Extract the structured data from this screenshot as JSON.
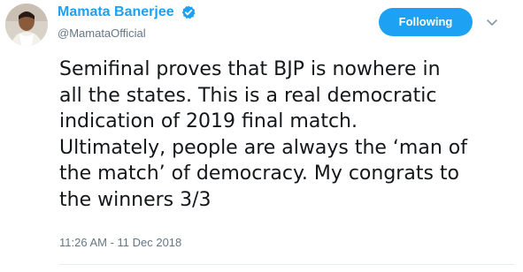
{
  "user": {
    "display_name": "Mamata Banerjee",
    "handle": "@MamataOfficial",
    "verified_icon": "verified-badge-icon"
  },
  "actions": {
    "follow_label": "Following",
    "more_icon": "chevron-down-icon"
  },
  "tweet": {
    "lines": [
      "Semifinal proves that BJP is nowhere in",
      "all the states. This is a real democratic",
      "indication of 2019 final match.",
      "Ultimately, people are always the ‘man of",
      "the match’ of democracy. My congrats to",
      "the winners 3/3"
    ],
    "timestamp": "11:26 AM - 11 Dec 2018"
  },
  "colors": {
    "accent": "#1da1f2",
    "secondary_text": "#657786",
    "primary_text": "#14171a",
    "divider": "#e6ecf0"
  }
}
